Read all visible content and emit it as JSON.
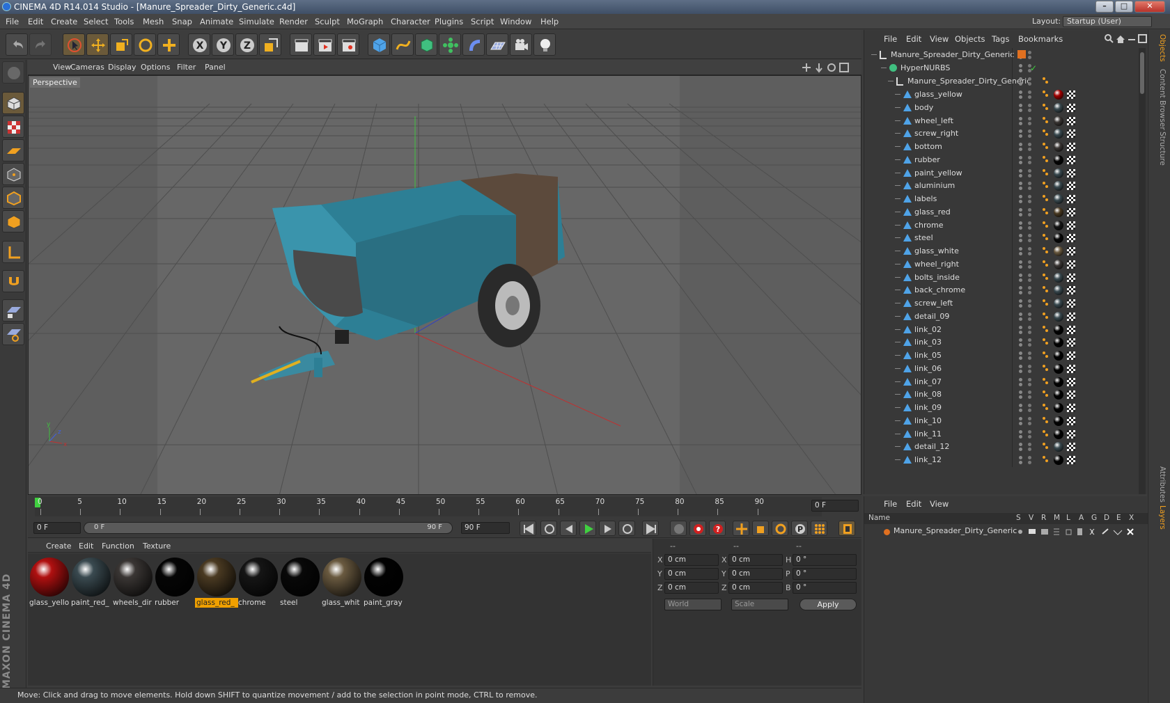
{
  "window": {
    "title": "CINEMA 4D R14.014 Studio - [Manure_Spreader_Dirty_Generic.c4d]",
    "buttons": [
      "–",
      "□",
      "✕"
    ]
  },
  "menubar": {
    "items": [
      "File",
      "Edit",
      "Create",
      "Select",
      "Tools",
      "Mesh",
      "Snap",
      "Animate",
      "Simulate",
      "Render",
      "Sculpt",
      "MoGraph",
      "Character",
      "Plugins",
      "Script",
      "Window",
      "Help"
    ],
    "layout_label": "Layout:",
    "layout_value": "Startup (User)"
  },
  "viewport": {
    "menu": [
      "View",
      "Cameras",
      "Display",
      "Options",
      "Filter",
      "Panel"
    ],
    "label": "Perspective"
  },
  "timeline": {
    "ticks": [
      "0",
      "5",
      "10",
      "15",
      "20",
      "25",
      "30",
      "35",
      "40",
      "45",
      "50",
      "55",
      "60",
      "65",
      "70",
      "75",
      "80",
      "85",
      "90"
    ],
    "current_frame": "0 F",
    "start_field": "0 F",
    "range_start": "0 F",
    "range_end": "90 F",
    "end_field": "90 F"
  },
  "material_manager": {
    "menu": [
      "Create",
      "Edit",
      "Function",
      "Texture"
    ],
    "materials": [
      {
        "label": "glass_yello",
        "color": "#b01010",
        "selected": false
      },
      {
        "label": "paint_red_",
        "color": "#3a4a50",
        "selected": false
      },
      {
        "label": "wheels_dir",
        "color": "#3a3634",
        "selected": false
      },
      {
        "label": "rubber",
        "color": "#050505",
        "selected": false
      },
      {
        "label": "glass_red_",
        "color": "#4a3a22",
        "selected": true
      },
      {
        "label": "chrome",
        "color": "#151515",
        "selected": false
      },
      {
        "label": "steel",
        "color": "#080808",
        "selected": false
      },
      {
        "label": "glass_whit",
        "color": "#6a5a40",
        "selected": false
      },
      {
        "label": "paint_gray",
        "color": "#020202",
        "selected": false
      }
    ]
  },
  "coordinates": {
    "header": [
      "--",
      "--",
      "--"
    ],
    "rows": [
      {
        "a": "X",
        "av": "0 cm",
        "b": "X",
        "bv": "0 cm",
        "c": "H",
        "cv": "0 °"
      },
      {
        "a": "Y",
        "av": "0 cm",
        "b": "Y",
        "bv": "0 cm",
        "c": "P",
        "cv": "0 °"
      },
      {
        "a": "Z",
        "av": "0 cm",
        "b": "Z",
        "bv": "0 cm",
        "c": "B",
        "cv": "0 °"
      }
    ],
    "world": "World",
    "scale": "Scale",
    "apply": "Apply"
  },
  "status": "Move: Click and drag to move elements. Hold down SHIFT to quantize movement / add to the selection in point mode, CTRL to remove.",
  "object_manager": {
    "menu": [
      "File",
      "Edit",
      "View",
      "Objects",
      "Tags",
      "Bookmarks"
    ],
    "root": "Manure_Spreader_Dirty_Generic",
    "hypernurbs": "HyperNURBS",
    "group": "Manure_Spreader_Dirty_Generic",
    "children": [
      {
        "name": "glass_yellow",
        "mat": "#a00000"
      },
      {
        "name": "body",
        "mat": "#3a4a50"
      },
      {
        "name": "wheel_left",
        "mat": "#3a3634"
      },
      {
        "name": "screw_right",
        "mat": "#3a4a50"
      },
      {
        "name": "bottom",
        "mat": "#3a3634"
      },
      {
        "name": "rubber",
        "mat": "#050505"
      },
      {
        "name": "paint_yellow",
        "mat": "#3a4a50"
      },
      {
        "name": "aluminium",
        "mat": "#3a4a50"
      },
      {
        "name": "labels",
        "mat": "#3a4a50"
      },
      {
        "name": "glass_red",
        "mat": "#4a3a22"
      },
      {
        "name": "chrome",
        "mat": "#151515"
      },
      {
        "name": "steel",
        "mat": "#080808"
      },
      {
        "name": "glass_white",
        "mat": "#6a5a40"
      },
      {
        "name": "wheel_right",
        "mat": "#3a3634"
      },
      {
        "name": "bolts_inside",
        "mat": "#3a4a50"
      },
      {
        "name": "back_chrome",
        "mat": "#3a4a50"
      },
      {
        "name": "screw_left",
        "mat": "#3a4a50"
      },
      {
        "name": "detail_09",
        "mat": "#3a4a50"
      },
      {
        "name": "link_02",
        "mat": "#020202"
      },
      {
        "name": "link_03",
        "mat": "#020202"
      },
      {
        "name": "link_05",
        "mat": "#020202"
      },
      {
        "name": "link_06",
        "mat": "#020202"
      },
      {
        "name": "link_07",
        "mat": "#020202"
      },
      {
        "name": "link_08",
        "mat": "#020202"
      },
      {
        "name": "link_09",
        "mat": "#020202"
      },
      {
        "name": "link_10",
        "mat": "#020202"
      },
      {
        "name": "link_11",
        "mat": "#020202"
      },
      {
        "name": "detail_12",
        "mat": "#3a4a50"
      },
      {
        "name": "link_12",
        "mat": "#020202"
      }
    ]
  },
  "layer_manager": {
    "menu": [
      "File",
      "Edit",
      "View"
    ],
    "columns": [
      "Name",
      "S",
      "V",
      "R",
      "M",
      "L",
      "A",
      "G",
      "D",
      "E",
      "X"
    ],
    "layer": "Manure_Spreader_Dirty_Generic"
  },
  "right_tabs": [
    "Objects",
    "Content Browser",
    "Structure",
    "Attributes",
    "Layers"
  ]
}
